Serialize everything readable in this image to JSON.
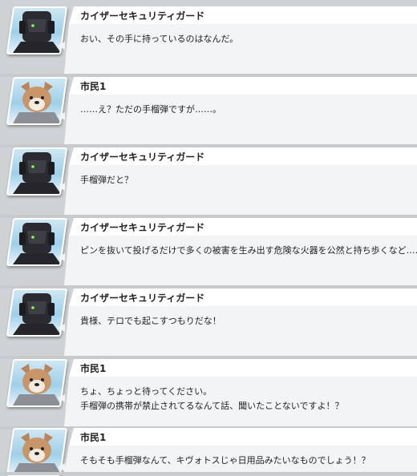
{
  "log": {
    "entries": [
      {
        "speaker": "カイザーセキュリティガード",
        "avatar": "robot-guard-icon",
        "text": "おい、その手に持っているのはなんだ。"
      },
      {
        "speaker": "市民1",
        "avatar": "dog-citizen-icon",
        "text": "……え？ただの手榴弾ですが……。"
      },
      {
        "speaker": "カイザーセキュリティガード",
        "avatar": "robot-guard-icon",
        "text": "手榴弾だと？"
      },
      {
        "speaker": "カイザーセキュリティガード",
        "avatar": "robot-guard-icon",
        "text": "ピンを抜いて投げるだけで多くの被害を生み出す危険な火器を公然と持ち歩くなど……。"
      },
      {
        "speaker": "カイザーセキュリティガード",
        "avatar": "robot-guard-icon",
        "text": "貴様、テロでも起こすつもりだな！"
      },
      {
        "speaker": "市民1",
        "avatar": "dog-citizen-icon",
        "text": "ちょ、ちょっと待ってください。\n手榴弾の携帯が禁止されてるなんて話、聞いたことないですよ！？"
      },
      {
        "speaker": "市民1",
        "avatar": "dog-citizen-icon",
        "text": "そもそも手榴弾なんて、キヴォトスじゃ日用品みたいなものでしょう！？"
      }
    ]
  }
}
